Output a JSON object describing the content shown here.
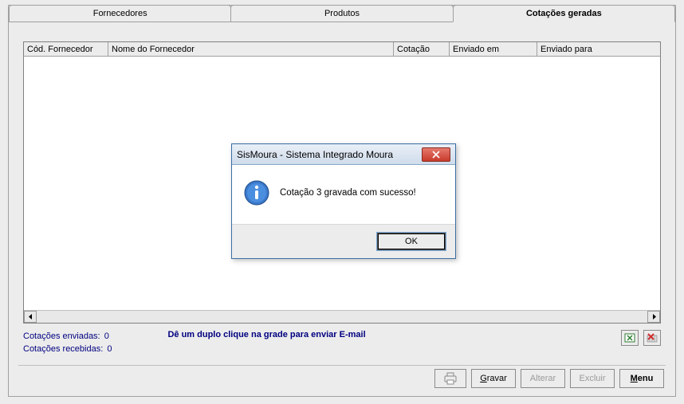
{
  "tabs": {
    "fornecedores": "Fornecedores",
    "produtos": "Produtos",
    "cotacoes": "Cotações geradas"
  },
  "grid": {
    "headers": {
      "cod": "Cód. Fornecedor",
      "nome": "Nome do Fornecedor",
      "cotacao": "Cotação",
      "enviado_em": "Enviado em",
      "enviado_para": "Enviado para"
    },
    "rows": []
  },
  "status": {
    "enviadas_label": "Cotações enviadas:",
    "enviadas_value": "0",
    "recebidas_label": "Cotações recebidas:",
    "recebidas_value": "0",
    "hint": "Dê um duplo clique na grade para enviar E-mail"
  },
  "icons": {
    "excel": "excel-icon",
    "delete_grid": "delete-icon"
  },
  "buttons": {
    "gravar": "Gravar",
    "alterar": "Alterar",
    "excluir": "Excluir",
    "menu": "Menu",
    "print": "print-icon"
  },
  "dialog": {
    "title": "SisMoura - Sistema Integrado Moura",
    "message": "Cotação 3 gravada com sucesso!",
    "ok": "OK"
  }
}
